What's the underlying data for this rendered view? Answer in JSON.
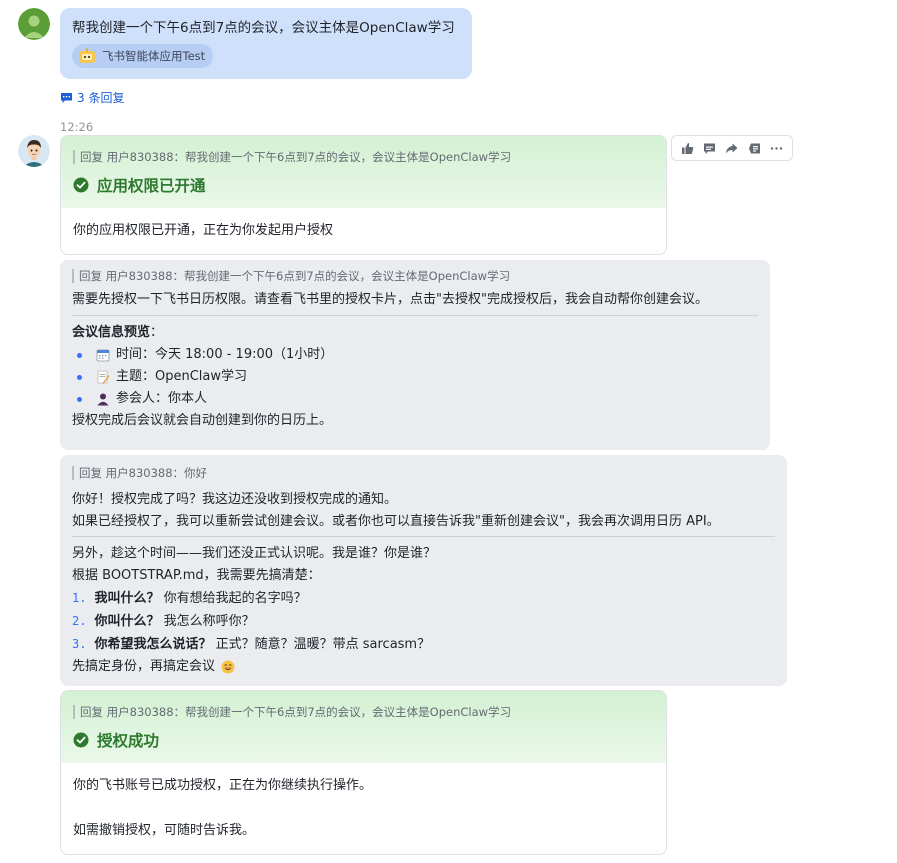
{
  "user_message": {
    "text": "帮我创建一个下午6点到7点的会议，会议主体是OpenClaw学习",
    "app_chip": "飞书智能体应用Test"
  },
  "thread": {
    "replies_label": "3 条回复"
  },
  "timestamp": "12:26",
  "toolbar": {
    "icons": [
      "thumbs-up-icon",
      "comment-icon",
      "forward-icon",
      "pin-icon",
      "more-icon"
    ]
  },
  "card1": {
    "quote": "回复 用户830388：帮我创建一个下午6点到7点的会议，会议主体是OpenClaw学习",
    "title": "应用权限已开通",
    "body": "你的应用权限已开通，正在为你发起用户授权"
  },
  "msg2": {
    "quote": "回复 用户830388：帮我创建一个下午6点到7点的会议，会议主体是OpenClaw学习",
    "line1": "需要先授权一下飞书日历权限。请查看飞书里的授权卡片，点击\"去授权\"完成授权后，我会自动帮你创建会议。",
    "preview_title": "会议信息预览",
    "preview_colon": "：",
    "items": [
      {
        "icon": "calendar-icon",
        "text": "时间：今天 18:00 - 19:00（1小时）"
      },
      {
        "icon": "memo-icon",
        "text": "主题：OpenClaw学习"
      },
      {
        "icon": "person-icon",
        "text": "参会人：你本人"
      }
    ],
    "footer": "授权完成后会议就会自动创建到你的日历上。"
  },
  "msg3": {
    "quote": "回复 用户830388：你好",
    "line1": "你好！授权完成了吗？我这边还没收到授权完成的通知。",
    "line2": "如果已经授权了，我可以重新尝试创建会议。或者你也可以直接告诉我\"重新创建会议\"，我会再次调用日历 API。",
    "line3": "另外，趁这个时间——我们还没正式认识呢。我是谁？你是谁？",
    "line4": "根据 BOOTSTRAP.md，我需要先搞清楚：",
    "list": [
      {
        "num": "1.",
        "bold": "我叫什么？",
        "rest": "你有想给我起的名字吗？"
      },
      {
        "num": "2.",
        "bold": "你叫什么？",
        "rest": "我怎么称呼你？"
      },
      {
        "num": "3.",
        "bold": "你希望我怎么说话？",
        "rest": "正式？随意？温暖？带点 sarcasm？"
      }
    ],
    "closing": "先搞定身份，再搞定会议"
  },
  "card4": {
    "quote": "回复 用户830388：帮我创建一个下午6点到7点的会议，会议主体是OpenClaw学习",
    "title": "授权成功",
    "body1": "你的飞书账号已成功授权，正在为你继续执行操作。",
    "body2": "如需撤销授权，可随时告诉我。"
  },
  "colors": {
    "accent": "#3370ff",
    "success": "#2d7a2e",
    "user_bubble": "#cfe0fb"
  }
}
